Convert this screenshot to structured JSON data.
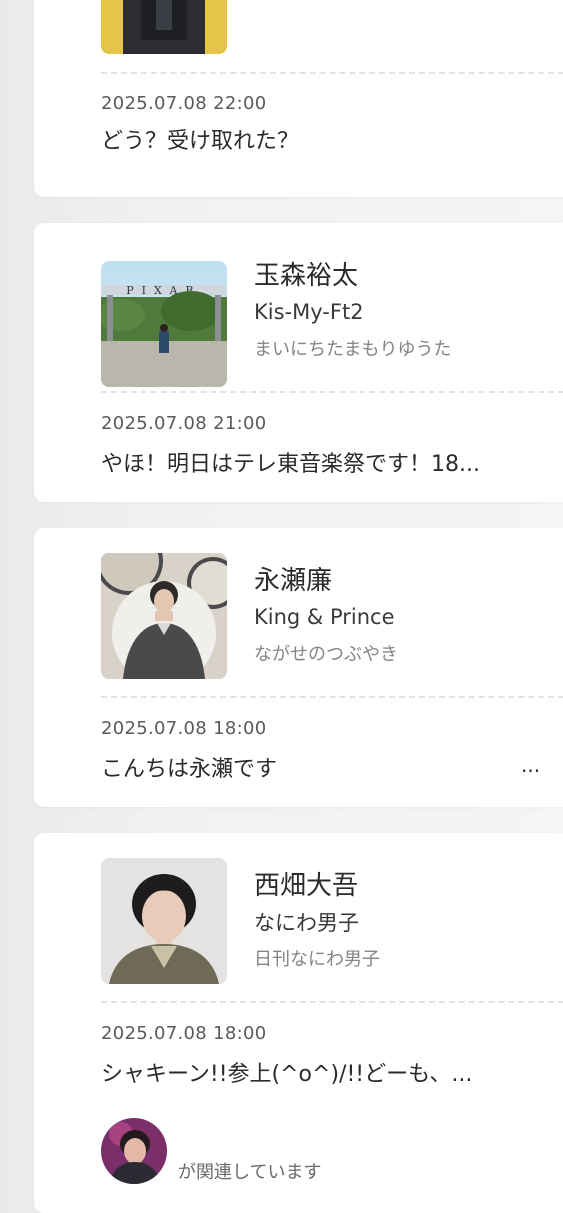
{
  "posts": [
    {
      "date": "2025.07.08 22:00",
      "message": "どう？受け取れた？"
    },
    {
      "name": "玉森裕太",
      "group": "Kis-My-Ft2",
      "blog_title": "まいにちたまもりゆうた",
      "thumb_text": "PIXAR",
      "date": "2025.07.08 21:00",
      "message": "やほ！明日はテレ東音楽祭です！18..."
    },
    {
      "name": "永瀬廉",
      "group": "King & Prince",
      "blog_title": "ながせのつぶやき",
      "date": "2025.07.08 18:00",
      "message": "こんちは永瀬です",
      "ellipsis": "..."
    },
    {
      "name": "西畑大吾",
      "group": "なにわ男子",
      "blog_title": "日刊なにわ男子",
      "date": "2025.07.08 18:00",
      "message": "シャキーン!!参上(^o^)/!!どーも、..."
    }
  ],
  "related": {
    "text": "が関連しています"
  },
  "colors": {
    "background": "#eef0f2",
    "card": "#ffffff",
    "divider": "#e3e3e3",
    "muted_text": "#858585"
  }
}
